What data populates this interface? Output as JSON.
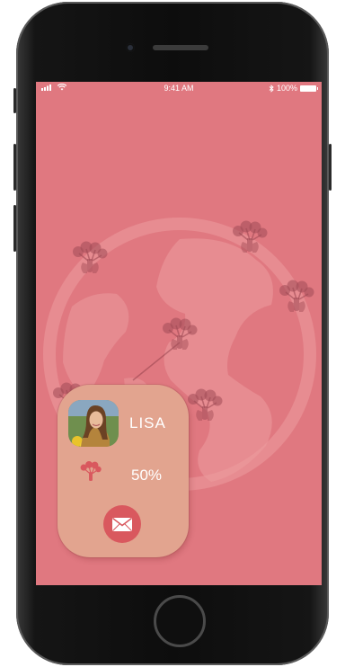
{
  "status_bar": {
    "time": "9:41 AM",
    "battery": "100%",
    "signal_icon": "signal-icon",
    "wifi_icon": "wifi-icon",
    "bluetooth_icon": "bluetooth-icon",
    "battery_icon": "battery-icon"
  },
  "map": {
    "background_color": "#e07880",
    "marker_icon": "tree-icon"
  },
  "card": {
    "name": "LISA",
    "progress": "50%",
    "avatar": "avatar-photo",
    "tree_icon": "tree-icon",
    "mail_icon": "mail-icon",
    "card_color": "#e2a48f",
    "mail_button_color": "#d9585e"
  }
}
